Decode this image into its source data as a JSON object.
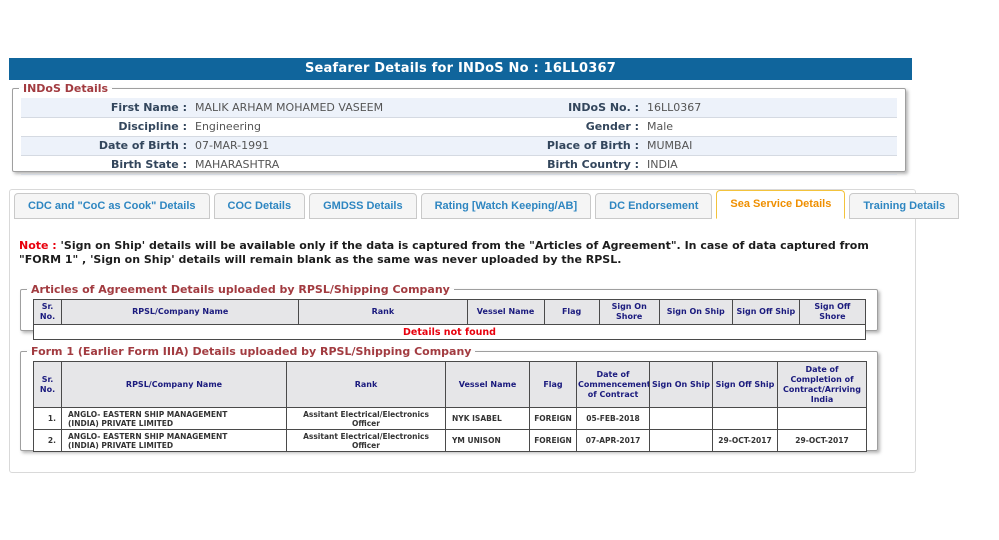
{
  "title": "Seafarer Details for INDoS No : 16LL0367",
  "indos": {
    "legend": "INDoS Details",
    "rows": [
      {
        "label_left": "First Name :",
        "value_left": "MALIK ARHAM MOHAMED VASEEM",
        "label_right": "INDoS No. :",
        "value_right": "16LL0367"
      },
      {
        "label_left": "Discipline :",
        "value_left": "Engineering",
        "label_right": "Gender :",
        "value_right": "Male"
      },
      {
        "label_left": "Date of Birth :",
        "value_left": "07-MAR-1991",
        "label_right": "Place of Birth :",
        "value_right": "MUMBAI"
      },
      {
        "label_left": "Birth State :",
        "value_left": "MAHARASHTRA",
        "label_right": "Birth Country :",
        "value_right": "INDIA"
      }
    ]
  },
  "tabs": [
    {
      "label": "CDC and \"CoC as Cook\" Details",
      "active": false
    },
    {
      "label": "COC Details",
      "active": false
    },
    {
      "label": "GMDSS Details",
      "active": false
    },
    {
      "label": "Rating [Watch Keeping/AB]",
      "active": false
    },
    {
      "label": "DC Endorsement",
      "active": false
    },
    {
      "label": "Sea Service Details",
      "active": true
    },
    {
      "label": "Training Details",
      "active": false
    }
  ],
  "note": {
    "prefix": "Note :",
    "body": " 'Sign on Ship' details will be available only if the data is captured from the \"Articles of Agreement\". In case of data captured from \"FORM 1\" , 'Sign on Ship' details will remain blank as the same was never uploaded by the RPSL."
  },
  "articles": {
    "legend": "Articles of Agreement Details uploaded by RPSL/Shipping Company",
    "headers": [
      "Sr. No.",
      "RPSL/Company Name",
      "Rank",
      "Vessel Name",
      "Flag",
      "Sign On Shore",
      "Sign On Ship",
      "Sign Off Ship",
      "Sign Off Shore"
    ],
    "empty_message": "Details not found"
  },
  "form1": {
    "legend": "Form 1 (Earlier Form IIIA) Details uploaded by RPSL/Shipping Company",
    "headers": [
      "Sr. No.",
      "RPSL/Company Name",
      "Rank",
      "Vessel Name",
      "Flag",
      "Date of Commencement of Contract",
      "Sign On Ship",
      "Sign Off Ship",
      "Date of Completion of Contract/Arriving India"
    ],
    "rows": [
      [
        "1.",
        "ANGLO- EASTERN SHIP MANAGEMENT (INDIA) PRIVATE LIMITED",
        "Assitant Electrical/Electronics Officer",
        "NYK ISABEL",
        "FOREIGN",
        "05-FEB-2018",
        "",
        "",
        ""
      ],
      [
        "2.",
        "ANGLO- EASTERN SHIP MANAGEMENT (INDIA) PRIVATE LIMITED",
        "Assitant Electrical/Electronics Officer",
        "YM UNISON",
        "FOREIGN",
        "07-APR-2017",
        "",
        "29-OCT-2017",
        "29-OCT-2017"
      ]
    ]
  },
  "colors": {
    "title_bar_bg": "#10659c",
    "legend_text": "#a23b40",
    "note_red": "#e8000d",
    "tab_text": "#2e86c1",
    "active_tab_text": "#ef8f00",
    "active_tab_border": "#f3c33c",
    "table_header_text": "#1b1b7e",
    "details_not_found_red": "#e8000d",
    "stripe_row_bg": "#edf2fa"
  }
}
